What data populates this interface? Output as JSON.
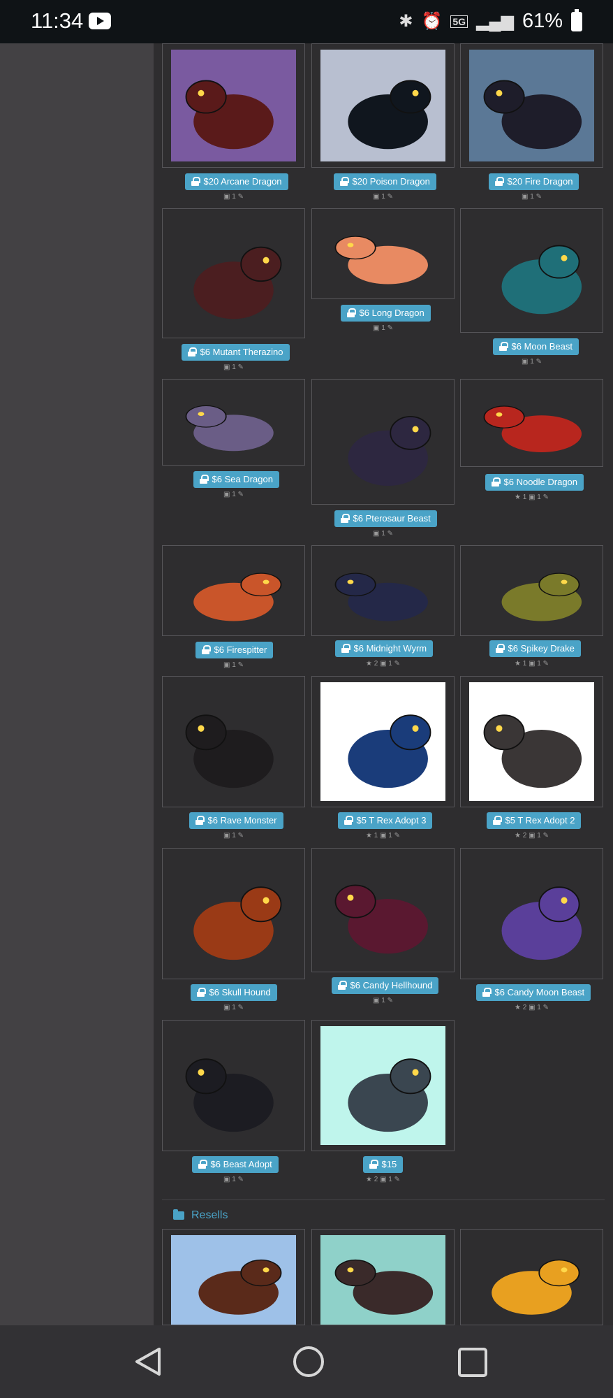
{
  "status_bar": {
    "time": "11:34",
    "signal": "5G",
    "battery": "61%"
  },
  "adopts": [
    {
      "label": "$20 Arcane Dragon",
      "meta": "▣ 1 ✎",
      "bg": "#7a5aa0",
      "fg": "#5a1a1a"
    },
    {
      "label": "$20 Poison Dragon",
      "meta": "▣ 1 ✎",
      "bg": "#b8bfd0",
      "fg": "#10161e"
    },
    {
      "label": "$20 Fire Dragon",
      "meta": "▣ 1 ✎",
      "bg": "#5b7896",
      "fg": "#1e1d2a"
    },
    {
      "label": "$6 Mutant Therazino",
      "meta": "▣ 1 ✎",
      "bg": "#2e2d2f",
      "fg": "#4b1e20"
    },
    {
      "label": "$6 Long Dragon",
      "meta": "▣ 1 ✎",
      "bg": "#2e2d2f",
      "fg": "#e88a62"
    },
    {
      "label": "$6 Moon Beast",
      "meta": "▣ 1 ✎",
      "bg": "#2e2d2f",
      "fg": "#1f6f78"
    },
    {
      "label": "$6 Sea Dragon",
      "meta": "▣ 1 ✎",
      "bg": "#2e2d2f",
      "fg": "#6a5d86"
    },
    {
      "label": "$6 Pterosaur Beast",
      "meta": "▣ 1 ✎",
      "bg": "#2e2d2f",
      "fg": "#2d2740"
    },
    {
      "label": "$6 Noodle Dragon",
      "meta": "★ 1 ▣ 1 ✎",
      "bg": "#2e2d2f",
      "fg": "#b8261e"
    },
    {
      "label": "$6 Firespitter",
      "meta": "▣ 1 ✎",
      "bg": "#2e2d2f",
      "fg": "#c9552a"
    },
    {
      "label": "$6 Midnight Wyrm",
      "meta": "★ 2 ▣ 1 ✎",
      "bg": "#2e2d2f",
      "fg": "#242848"
    },
    {
      "label": "$6 Spikey Drake",
      "meta": "★ 1 ▣ 1 ✎",
      "bg": "#2e2d2f",
      "fg": "#7a7a2a"
    },
    {
      "label": "$6 Rave Monster",
      "meta": "▣ 1 ✎",
      "bg": "#2e2d2f",
      "fg": "#1e1c1e"
    },
    {
      "label": "$5 T Rex Adopt 3",
      "meta": "★ 1 ▣ 1 ✎",
      "bg": "#ffffff",
      "fg": "#1a3c7a"
    },
    {
      "label": "$5 T Rex Adopt 2",
      "meta": "★ 2 ▣ 1 ✎",
      "bg": "#ffffff",
      "fg": "#3a3636"
    },
    {
      "label": "$6 Skull Hound",
      "meta": "▣ 1 ✎",
      "bg": "#2e2d2f",
      "fg": "#9a3a16"
    },
    {
      "label": "$6 Candy Hellhound",
      "meta": "▣ 1 ✎",
      "bg": "#2e2d2f",
      "fg": "#5a1830"
    },
    {
      "label": "$6 Candy Moon Beast",
      "meta": "★ 2 ▣ 1 ✎",
      "bg": "#2e2d2f",
      "fg": "#5a3f9a"
    },
    {
      "label": "$6 Beast Adopt",
      "meta": "▣ 1 ✎",
      "bg": "#2e2d2f",
      "fg": "#1c1c22"
    },
    {
      "label": "$15",
      "meta": "★ 2 ▣ 1 ✎",
      "bg": "#bff5ec",
      "fg": "#3a4650"
    }
  ],
  "folder": {
    "name": "Resells"
  },
  "resells": [
    {
      "bg": "#9ec1e8",
      "fg": "#5a2a1a"
    },
    {
      "bg": "#8fd1c9",
      "fg": "#3a2a2a"
    },
    {
      "bg": "#2e2d2f",
      "fg": "#e8a020"
    }
  ]
}
